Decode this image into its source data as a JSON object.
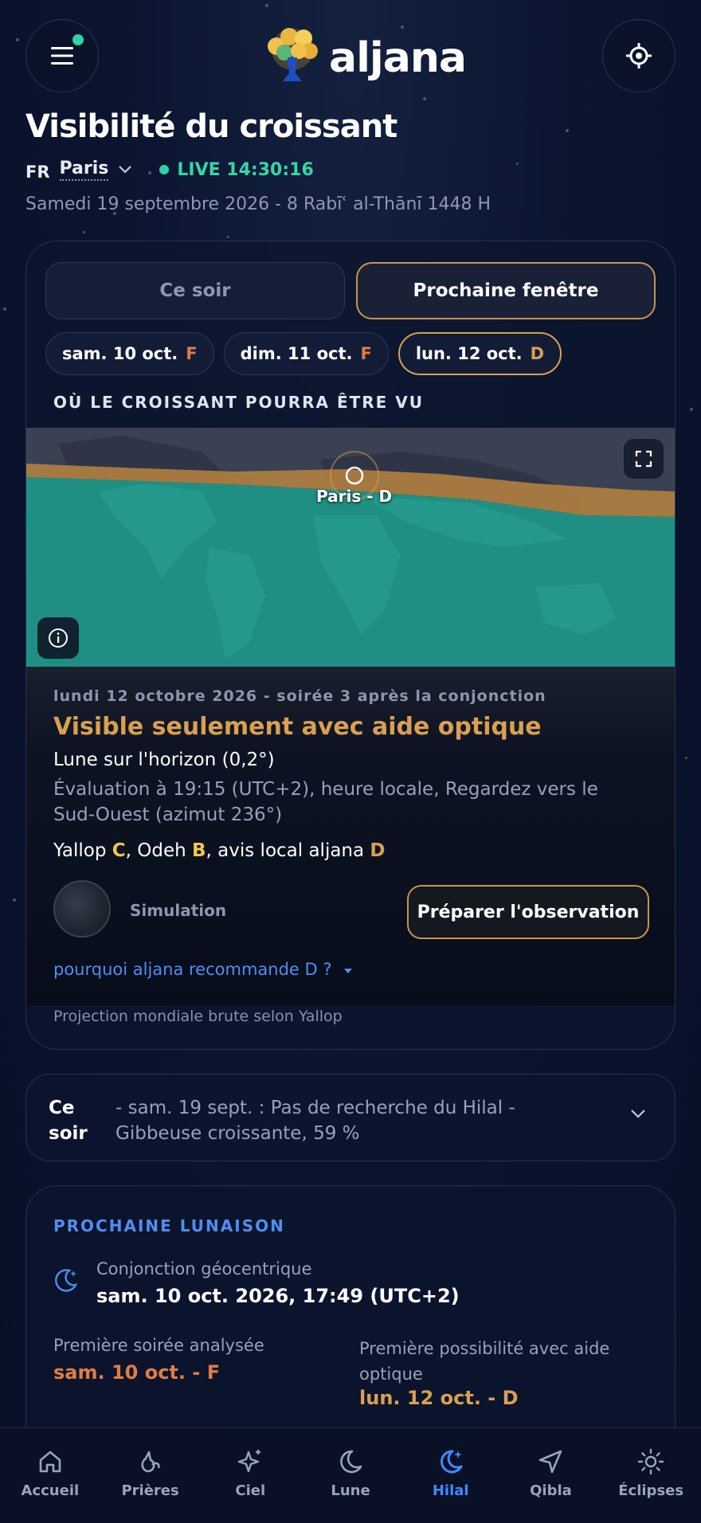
{
  "header": {
    "logo_text": "aljana"
  },
  "page": {
    "title": "Visibilité du croissant",
    "country_code": "FR",
    "city": "Paris",
    "live_label": "LIVE 14:30:16",
    "date_line": "Samedi 19 septembre 2026 - 8 Rabīʿ al-Thānī 1448 H"
  },
  "tabs": [
    {
      "label": "Ce soir",
      "active": false
    },
    {
      "label": "Prochaine fenêtre",
      "active": true
    }
  ],
  "days": [
    {
      "label": "sam. 10 oct.",
      "grade": "F"
    },
    {
      "label": "dim. 11 oct.",
      "grade": "F"
    },
    {
      "label": "lun. 12 oct.",
      "grade": "D"
    }
  ],
  "map": {
    "section_title": "OÙ LE CROISSANT POURRA ÊTRE VU",
    "marker_label": "Paris - D"
  },
  "result": {
    "subtitle": "lundi 12 octobre 2026 - soirée 3 après la conjonction",
    "verdict": "Visible seulement avec aide optique",
    "moon_line": "Lune sur l'horizon (0,2°)",
    "eval_line": "Évaluation à 19:15 (UTC+2), heure locale, Regardez vers le Sud-Ouest (azimut 236°)",
    "yallop_label": "Yallop",
    "yallop_grade": "C",
    "odeh_label": ", Odeh",
    "odeh_grade": "B",
    "local_label": ", avis local aljana",
    "local_grade": "D",
    "sim_label": "Simulation",
    "prepare_button": "Préparer l'observation",
    "why_link": "pourquoi aljana recommande D ?",
    "projection_note": "Projection mondiale brute selon Yallop"
  },
  "tonight": {
    "label_1": "Ce",
    "label_2": "soir",
    "text": "- sam. 19 sept. : Pas de recherche du Hilal - Gibbeuse croissante, 59 %"
  },
  "lunaison": {
    "title": "PROCHAINE LUNAISON",
    "conj_label": "Conjonction géocentrique",
    "conj_value": "sam. 10 oct. 2026, 17:49 (UTC+2)",
    "first_eve_label": "Première soirée analysée",
    "first_eve_value": "sam. 10 oct. - F",
    "first_opt_label": "Première possibilité avec aide optique",
    "first_opt_value": "lun. 12 oct. - D"
  },
  "nav": [
    {
      "label": "Accueil",
      "icon": "home-icon"
    },
    {
      "label": "Prières",
      "icon": "prayer-icon"
    },
    {
      "label": "Ciel",
      "icon": "sparkle-icon"
    },
    {
      "label": "Lune",
      "icon": "moon-icon"
    },
    {
      "label": "Hilal",
      "icon": "crescent-icon",
      "active": true
    },
    {
      "label": "Qibla",
      "icon": "compass-arrow-icon"
    },
    {
      "label": "Éclipses",
      "icon": "sun-icon"
    }
  ],
  "colors": {
    "accent_gold": "#d9a052",
    "accent_orange": "#e27c41",
    "accent_blue": "#3f8cff",
    "live_green": "#35d6a8"
  }
}
